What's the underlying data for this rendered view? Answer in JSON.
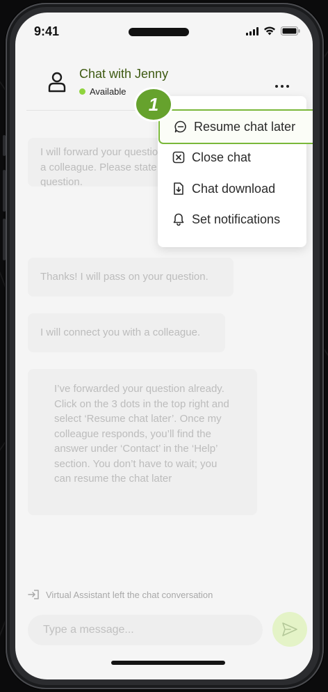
{
  "status_bar": {
    "time": "9:41"
  },
  "chat_header": {
    "title": "Chat with Jenny",
    "status": "Available",
    "status_color": "#8fd43e"
  },
  "messages": [
    {
      "text": "I will forward your question to a colleague. Please state your question."
    },
    {
      "text": "Thanks! I will pass on your question."
    },
    {
      "text": "I will connect you with a colleague."
    },
    {
      "text": "I’ve forwarded your question already. Click on the 3 dots in the top right and select ‘Resume chat later’. Once my colleague responds, you’ll find the answer under ‘Contact’ in the ‘Help’ section. You don’t have to wait; you can resume the chat later"
    }
  ],
  "menu": {
    "step_badge": "1",
    "items": [
      {
        "label": "Resume chat later",
        "icon": "chat-bubble-icon"
      },
      {
        "label": "Close chat",
        "icon": "close-box-icon"
      },
      {
        "label": "Chat download",
        "icon": "download-file-icon"
      },
      {
        "label": "Set notifications",
        "icon": "bell-icon"
      }
    ]
  },
  "system_note": "Virtual Assistant left the chat conversation",
  "composer": {
    "placeholder": "Type a message..."
  },
  "colors": {
    "accent": "#66a22d",
    "highlight_border": "#7ab83a",
    "header_title": "#3e5a12"
  }
}
